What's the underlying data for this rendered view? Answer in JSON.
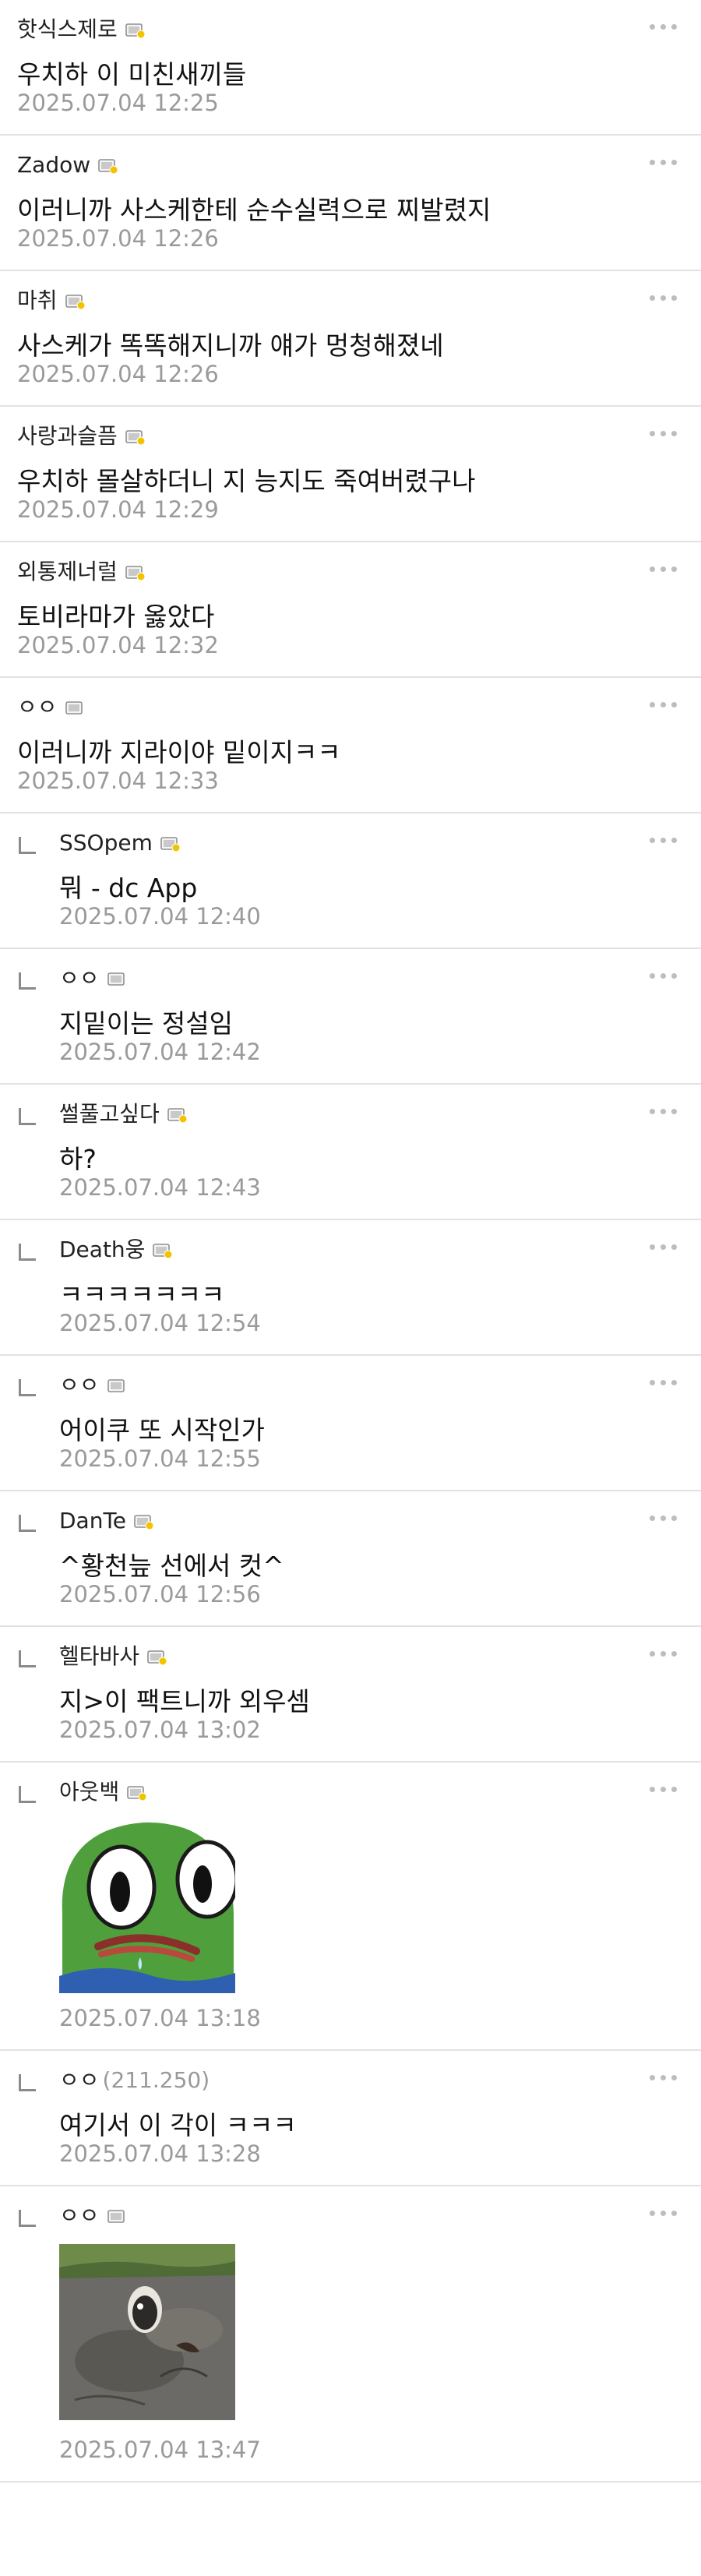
{
  "comments": [
    {
      "nick": "핫식스제로",
      "badge": "gold",
      "text": "우치하 이 미친새끼들",
      "time": "2025.07.04 12:25",
      "reply": false
    },
    {
      "nick": "Zadow",
      "badge": "gold",
      "text": "이러니까 사스케한테 순수실력으로 찌발렸지",
      "time": "2025.07.04 12:26",
      "reply": false
    },
    {
      "nick": "마취",
      "badge": "gold",
      "text": "사스케가 똑똑해지니까 얘가 멍청해졌네",
      "time": "2025.07.04 12:26",
      "reply": false
    },
    {
      "nick": "사랑과슬픔",
      "badge": "gold",
      "text": "우치하 몰살하더니 지 능지도 죽여버렸구나",
      "time": "2025.07.04 12:29",
      "reply": false
    },
    {
      "nick": "외통제너럴",
      "badge": "gold",
      "text": "토비라마가 옳았다",
      "time": "2025.07.04 12:32",
      "reply": false
    },
    {
      "nick": "ㅇㅇ",
      "badge": "grey",
      "text": "이러니까 지라이야 밑이지ㅋㅋ",
      "time": "2025.07.04 12:33",
      "reply": false
    },
    {
      "nick": "SSOpem",
      "badge": "gold",
      "text": "뭐 - dc App",
      "time": "2025.07.04 12:40",
      "reply": true
    },
    {
      "nick": "ㅇㅇ",
      "badge": "grey",
      "text": "지밑이는 정설임",
      "time": "2025.07.04 12:42",
      "reply": true
    },
    {
      "nick": "썰풀고싶다",
      "badge": "gold",
      "text": "하?",
      "time": "2025.07.04 12:43",
      "reply": true
    },
    {
      "nick": "Death웅",
      "badge": "gold",
      "text": "ㅋㅋㅋㅋㅋㅋㅋ",
      "time": "2025.07.04 12:54",
      "reply": true
    },
    {
      "nick": "ㅇㅇ",
      "badge": "grey",
      "text": "어이쿠 또 시작인가",
      "time": "2025.07.04 12:55",
      "reply": true
    },
    {
      "nick": "DanTe",
      "badge": "gold",
      "text": "^황천늪 선에서 컷^",
      "time": "2025.07.04 12:56",
      "reply": true
    },
    {
      "nick": "헬타바사",
      "badge": "gold",
      "text": "지>이 팩트니까 외우셈",
      "time": "2025.07.04 13:02",
      "reply": true
    },
    {
      "nick": "아웃백",
      "badge": "gold",
      "text": "",
      "time": "2025.07.04 13:18",
      "reply": true,
      "image": "pepe-frog-sticker"
    },
    {
      "nick": "ㅇㅇ",
      "ip": "(211.250)",
      "badge": "none",
      "text": "여기서 이 각이 ㅋㅋㅋ",
      "time": "2025.07.04 13:28",
      "reply": true
    },
    {
      "nick": "ㅇㅇ",
      "badge": "grey",
      "text": "",
      "time": "2025.07.04 13:47",
      "reply": true,
      "image": "mud-animal-photo"
    }
  ],
  "icons": {
    "more": "more-dots-icon",
    "reply": "reply-arrow-icon",
    "badge": "member-badge-icon"
  },
  "colors": {
    "text": "#111111",
    "nick": "#222222",
    "time": "#9a9a9a",
    "divider": "#e2e2e2",
    "badge_gold": "#f2c400",
    "badge_grey": "#9a9a9a"
  }
}
